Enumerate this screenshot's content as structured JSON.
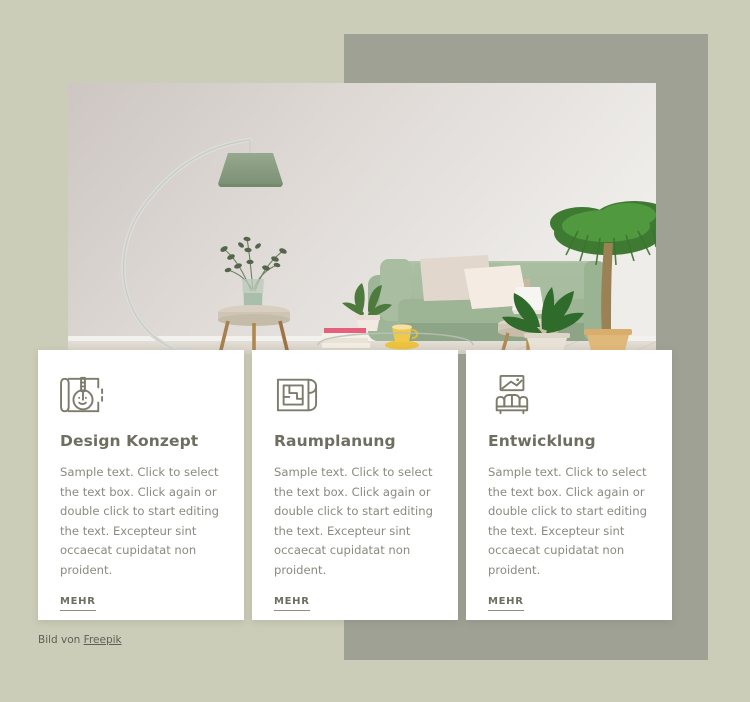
{
  "theme": {
    "page_background": "#cccdb9",
    "accent_block": "#9ea194",
    "card_background": "#ffffff",
    "heading_color": "#6e6e61",
    "body_text_color": "#8a8a80",
    "link_color": "#6e6e61"
  },
  "hero": {
    "alt": "Modernes Wohnzimmer mit grünem Sofa, Bogenlampe und Zimmerpflanzen"
  },
  "cards": [
    {
      "icon": "blueprint-drafting-tools-icon",
      "title": "Design Konzept",
      "text": "Sample text. Click to select the text box. Click again or double click to start editing the text. Excepteur sint occaecat cupidatat non proident.",
      "link_label": "MEHR"
    },
    {
      "icon": "floor-plan-scroll-icon",
      "title": "Raumplanung",
      "text": "Sample text. Click to select the text box. Click again or double click to start editing the text. Excepteur sint occaecat cupidatat non proident.",
      "link_label": "MEHR"
    },
    {
      "icon": "sofa-with-picture-frame-icon",
      "title": "Entwicklung",
      "text": "Sample text. Click to select the text box. Click again or double click to start editing the text. Excepteur sint occaecat cupidatat non proident.",
      "link_label": "MEHR"
    }
  ],
  "credit": {
    "prefix": "Bild von ",
    "source_label": "Freepik"
  }
}
